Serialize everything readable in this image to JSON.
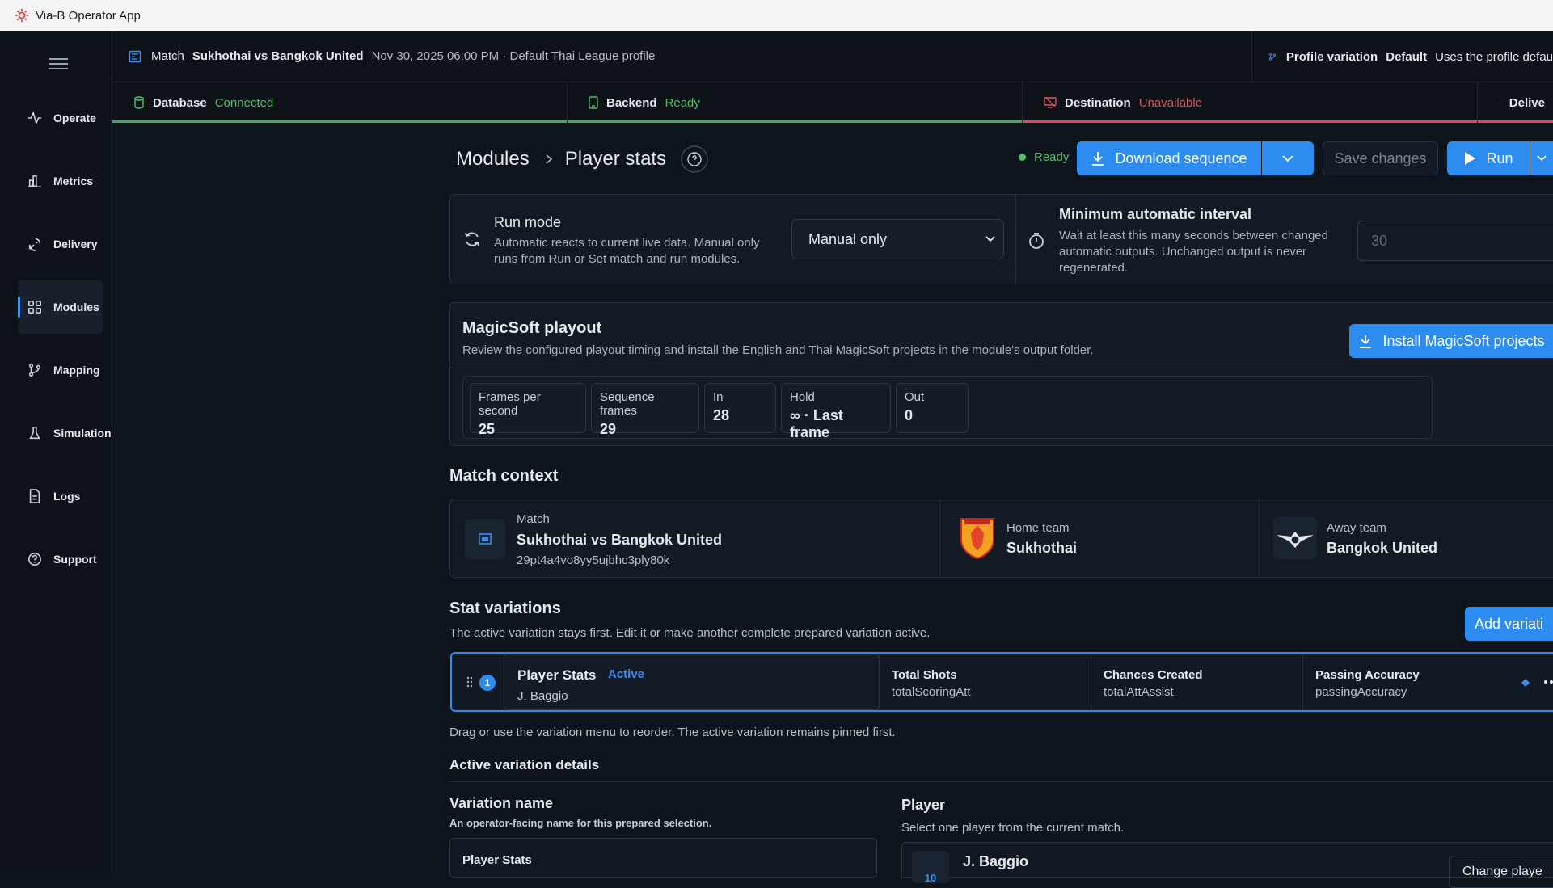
{
  "window": {
    "title": "Via-B Operator App"
  },
  "sidebar": {
    "items": [
      {
        "label": "Operate",
        "icon": "pulse-icon"
      },
      {
        "label": "Metrics",
        "icon": "bar-chart-icon"
      },
      {
        "label": "Delivery",
        "icon": "satellite-dish-icon"
      },
      {
        "label": "Modules",
        "icon": "grid-icon"
      },
      {
        "label": "Mapping",
        "icon": "branch-icon"
      },
      {
        "label": "Simulation",
        "icon": "flask-icon"
      },
      {
        "label": "Logs",
        "icon": "file-text-icon"
      },
      {
        "label": "Support",
        "icon": "help-circle-icon"
      }
    ],
    "active": "Modules"
  },
  "topbar": {
    "match_label": "Match",
    "match_name": "Sukhothai vs Bangkok United",
    "match_meta": "Nov 30, 2025 06:00 PM · Default Thai League profile",
    "profile_label": "Profile variation",
    "profile_value": "Default",
    "profile_desc": "Uses the profile defau"
  },
  "status": [
    {
      "label": "Database",
      "value": "Connected",
      "state": "ok"
    },
    {
      "label": "Backend",
      "value": "Ready",
      "state": "ok"
    },
    {
      "label": "Destination",
      "value": "Unavailable",
      "state": "bad"
    },
    {
      "label": "Delive",
      "value": "",
      "state": "bad"
    }
  ],
  "colors": {
    "accent": "#2d8cf0",
    "ok": "#4ec06a",
    "bad": "#e0535d"
  },
  "header": {
    "breadcrumb_root": "Modules",
    "breadcrumb_current": "Player stats",
    "ready_label": "Ready",
    "download_label": "Download sequence",
    "save_label": "Save changes",
    "run_label": "Run"
  },
  "run_mode": {
    "title": "Run mode",
    "desc": "Automatic reacts to current live data. Manual only runs from Run or Set match and run modules.",
    "selected": "Manual only",
    "interval_title": "Minimum automatic interval",
    "interval_desc": "Wait at least this many seconds between changed automatic outputs. Unchanged output is never regenerated.",
    "interval_value": "30"
  },
  "magicsoft": {
    "title": "MagicSoft playout",
    "desc": "Review the configured playout timing and install the English and Thai MagicSoft projects in the module's output folder.",
    "install_label": "Install MagicSoft projects",
    "tiles": [
      {
        "label": "Frames per second",
        "value": "25"
      },
      {
        "label": "Sequence frames",
        "value": "29"
      },
      {
        "label": "In",
        "value": "28"
      },
      {
        "label": "Hold",
        "value": "∞ · Last frame"
      },
      {
        "label": "Out",
        "value": "0"
      }
    ]
  },
  "match_context": {
    "heading": "Match context",
    "match_label": "Match",
    "match_name": "Sukhothai vs Bangkok United",
    "match_id": "29pt4a4vo8yy5ujbhc3ply80k",
    "home_label": "Home team",
    "home_name": "Sukhothai",
    "away_label": "Away team",
    "away_name": "Bangkok United"
  },
  "variations": {
    "heading": "Stat variations",
    "desc": "The active variation stays first. Edit it or make another complete prepared variation active.",
    "add_label": "Add variati",
    "row": {
      "index": "1",
      "name": "Player Stats",
      "badge": "Active",
      "player": "J. Baggio",
      "stats": [
        {
          "title": "Total Shots",
          "key": "totalScoringAtt"
        },
        {
          "title": "Chances Created",
          "key": "totalAttAssist"
        },
        {
          "title": "Passing Accuracy",
          "key": "passingAccuracy"
        }
      ]
    },
    "hint": "Drag or use the variation menu to reorder. The active variation remains pinned first."
  },
  "details": {
    "heading": "Active variation details",
    "name_label": "Variation name",
    "name_help": "An operator-facing name for this prepared selection.",
    "name_value": "Player Stats",
    "player_label": "Player",
    "player_help": "Select one player from the current match.",
    "player_name": "J. Baggio",
    "player_number": "10",
    "change_label": "Change playe"
  }
}
